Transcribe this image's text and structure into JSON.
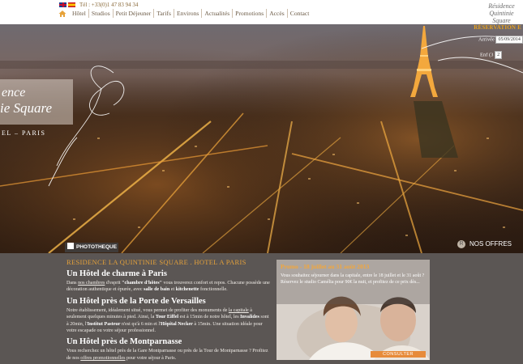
{
  "header": {
    "phone": "Tél : +33(0)1 47 83 94 34",
    "nav": [
      "Hôtel",
      "Studios",
      "Petit Déjeuner",
      "Tarifs",
      "Environs",
      "Actualités",
      "Promotions",
      "Accès",
      "Contact"
    ],
    "logo_line1": "Résidence",
    "logo_line2": "Quintinie Square"
  },
  "reservation": {
    "title": "RÉSERVATION E",
    "arrival_label": "Arrivée",
    "arrival_value": "05/09/2014",
    "nights_label": "Enf (3",
    "nights_value": "2"
  },
  "hero": {
    "brand_line1": "ence",
    "brand_line2": "ie Square",
    "brand_line3": "EL – PARIS",
    "phototheque": "PHOTOTHEQUE",
    "offers": "NOS OFFRES"
  },
  "main": {
    "heading": "RESIDENCE LA QUINTINIE SQUARE . HOTEL A PARIS",
    "sections": [
      {
        "title": "Un Hôtel de charme à Paris",
        "text_a": "Dans ",
        "link": "nos chambres",
        "text_b": " d'esprit ",
        "bold1": "\"chambre d'hôtes\"",
        "text_c": " vous trouverez confort et repos. Chacune possède une décoration authentique et épurée, avec ",
        "bold2": "salle de bain",
        "text_d": " et ",
        "bold3": "kitchenette",
        "text_e": " fonctionnelle."
      },
      {
        "title": "Un Hôtel près de la Porte de Versailles",
        "text_a": "Notre établissement, idéalement situé, vous permet de profiter des monuments de ",
        "link": "la capitale",
        "text_b": " à seulement quelques minutes à pied. Ainsi, la ",
        "bold1": "Tour Eiffel",
        "text_c": " est à 15min de notre hôtel, les ",
        "bold2": "Invalides",
        "text_d": " sont à 20min, l'",
        "bold3": "Institut Pasteur",
        "text_e": " n'est qu'à 6 min et l'",
        "bold4": "Hôpital Necker",
        "text_f": " à 15min. Une situation idéale pour votre escapade ou votre séjour professionnel."
      },
      {
        "title": "Un Hôtel près de Montparnasse",
        "text_a": "Vous recherchez un hôtel près de la Gare Montparnasse ou près de la Tour de Montparnasse ? Profitez de nos ",
        "link": "offres promotionnelles",
        "text_b": " pour votre séjour à Paris."
      }
    ]
  },
  "promo": {
    "title": "Promo - 18 juillet au 31 août 2013",
    "description": "Vous souhaitez séjourner dans la capitale, entre le 18 juillet et le 31 août ? Réservez le studio Camélia pour 90€ la nuit, et profitez de ce prix dès...",
    "button": "CONSULTER"
  },
  "colors": {
    "accent": "#e6a23a",
    "content_bg": "#5b5654",
    "button": "#e78b3a"
  }
}
